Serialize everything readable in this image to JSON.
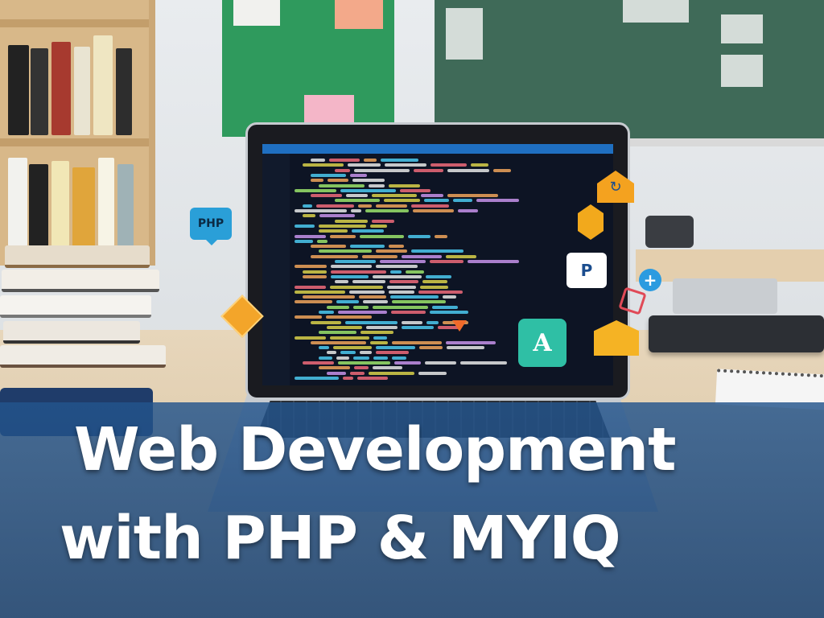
{
  "title": {
    "line1": "Web Development",
    "line2": "with PHP & MYIQ"
  },
  "floating_icons": {
    "php_badge": "PHP",
    "p_badge": "P",
    "a_badge": "A",
    "plus_glyph": "+",
    "house_glyph": "↻"
  },
  "colors": {
    "banner": "#23548c",
    "accent_orange": "#f4a21f",
    "accent_blue": "#2a9fd8",
    "accent_teal": "#2fbfa5"
  },
  "icons": [
    "php-badge",
    "diamond-icon",
    "house-icon",
    "hexagon-icon",
    "p-badge",
    "plus-icon",
    "tag-icon",
    "mail-icon",
    "a-badge",
    "triangle-icon"
  ]
}
